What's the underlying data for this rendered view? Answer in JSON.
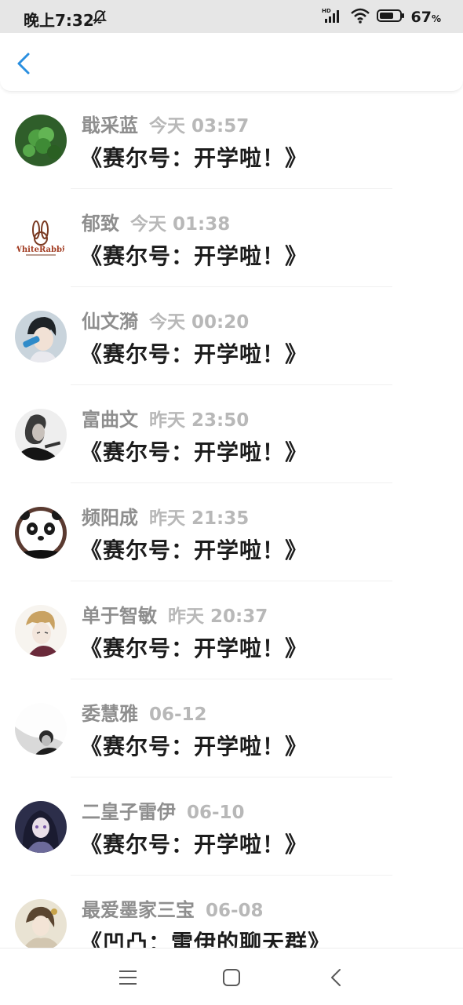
{
  "status_bar": {
    "time": "晚上7:32",
    "battery": "67",
    "battery_unit": "%",
    "network": "HD"
  },
  "header": {
    "back_icon": "chevron-left-icon",
    "accent": "#2a8fe0"
  },
  "items": [
    {
      "name": "戢采蓝",
      "time": "今天 03:57",
      "title": "《赛尔号：开学啦！》"
    },
    {
      "name": "郁致",
      "time": "今天 01:38",
      "title": "《赛尔号：开学啦！》"
    },
    {
      "name": "仙文漪",
      "time": "今天 00:20",
      "title": "《赛尔号：开学啦！》"
    },
    {
      "name": "富曲文",
      "time": "昨天 23:50",
      "title": "《赛尔号：开学啦！》"
    },
    {
      "name": "频阳成",
      "time": "昨天 21:35",
      "title": "《赛尔号：开学啦！》"
    },
    {
      "name": "单于智敏",
      "time": "昨天 20:37",
      "title": "《赛尔号：开学啦！》"
    },
    {
      "name": "委慧雅",
      "time": "06-12",
      "title": "《赛尔号：开学啦！》"
    },
    {
      "name": "二皇子雷伊",
      "time": "06-10",
      "title": "《赛尔号：开学啦！》"
    },
    {
      "name": "最爱墨家三宝",
      "time": "06-08",
      "title": "《凹凸：雷伊的聊天群》"
    }
  ],
  "avatar_logo_text": "WhiteRabbit",
  "nav_bar": {
    "menu_icon": "menu-icon",
    "home_icon": "home-square-icon",
    "back_icon": "back-triangle-icon"
  }
}
